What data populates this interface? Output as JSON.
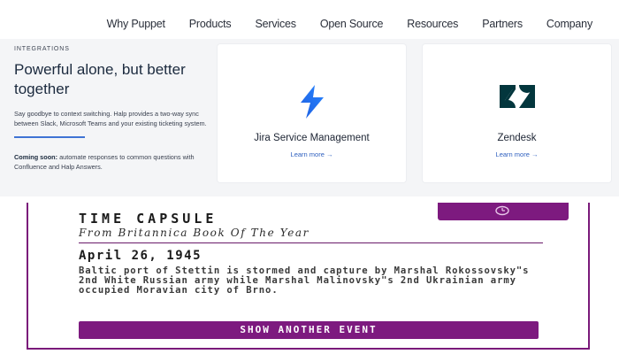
{
  "nav": {
    "items": [
      {
        "label": "Why Puppet"
      },
      {
        "label": "Products"
      },
      {
        "label": "Services"
      },
      {
        "label": "Open Source"
      },
      {
        "label": "Resources"
      },
      {
        "label": "Partners"
      },
      {
        "label": "Company"
      }
    ]
  },
  "integrations": {
    "eyebrow": "INTEGRATIONS",
    "headline": "Powerful alone, but better together",
    "description": "Say goodbye to context switching. Halp provides a two-way sync between Slack, Microsoft Teams and your existing ticketing system.",
    "coming_soon_label": "Coming soon:",
    "coming_soon_text": " automate responses to common questions with Confluence and Halp Answers.",
    "cards": [
      {
        "title": "Jira Service Management",
        "link": "Learn more →",
        "icon": "jira-icon"
      },
      {
        "title": "Zendesk",
        "link": "Learn more →",
        "icon": "zendesk-icon"
      }
    ]
  },
  "time_capsule": {
    "title": "TIME CAPSULE",
    "subtitle": "From Britannica Book Of The Year",
    "date": "April 26, 1945",
    "event": "Baltic port of Stettin is stormed and capture by Marshal Rokossovsky\"s 2nd White Russian army while Marshal Malinovsky\"s 2nd Ukrainian army occupied Moravian city of Brno.",
    "button": "SHOW ANOTHER EVENT",
    "icon": "clock-icon"
  },
  "colors": {
    "accent_blue": "#3f73d4",
    "capsule_purple": "#7d1a7f",
    "band_bg": "#f4f5f7"
  }
}
